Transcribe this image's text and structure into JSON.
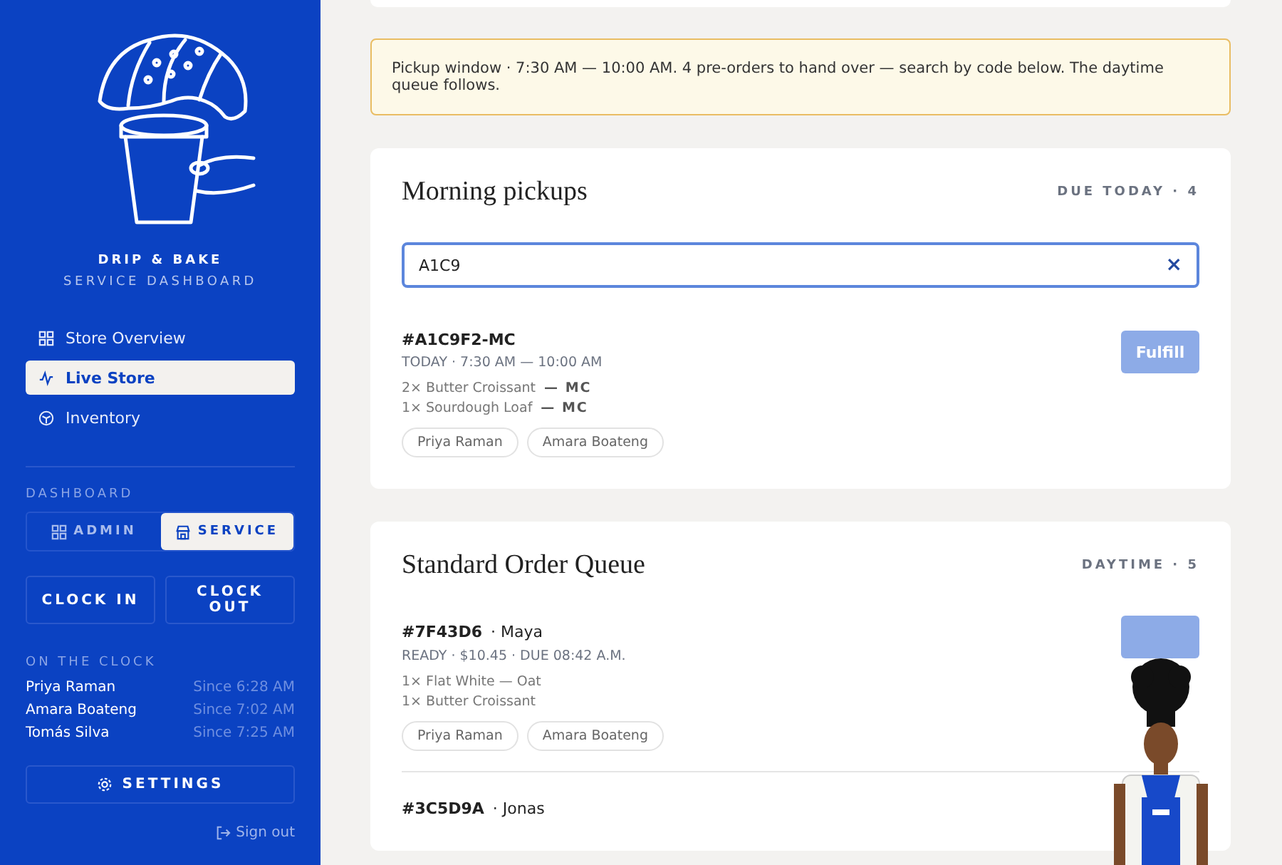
{
  "sidebar": {
    "brand": "DRIP & BAKE",
    "subtitle": "SERVICE DASHBOARD",
    "nav": [
      {
        "label": "Store Overview",
        "selected": false
      },
      {
        "label": "Live Store",
        "selected": true
      },
      {
        "label": "Inventory",
        "selected": false
      }
    ],
    "dashboard_label": "DASHBOARD",
    "mode_toggle": [
      {
        "label": "ADMIN",
        "selected": false
      },
      {
        "label": "SERVICE",
        "selected": true
      }
    ],
    "clock_buttons": [
      "CLOCK IN",
      "CLOCK OUT"
    ],
    "on_clock_label": "ON THE CLOCK",
    "staff": [
      {
        "name": "Priya Raman",
        "since": "Since 6:28 AM"
      },
      {
        "name": "Amara Boateng",
        "since": "Since 7:02 AM"
      },
      {
        "name": "Tomás Silva",
        "since": "Since 7:25 AM"
      }
    ],
    "settings": "SETTINGS",
    "sign_out": "Sign out"
  },
  "banner": "Pickup window · 7:30 AM — 10:00 AM. 4 pre-orders to hand over — search by code below. The daytime queue follows.",
  "pickups": {
    "title": "Morning pickups",
    "badge": "DUE TODAY · 4",
    "search": {
      "value": "A1C9",
      "clear": "×"
    },
    "orders": [
      {
        "code": "#A1C9F2-MC",
        "meta": "TODAY · 7:30 AM — 10:00 AM",
        "items": [
          {
            "text": "2× Butter Croissant",
            "tag": "— MC"
          },
          {
            "text": "1× Sourdough Loaf",
            "tag": "— MC"
          }
        ],
        "staff": [
          "Priya Raman",
          "Amara Boateng"
        ],
        "button": "Fulfill",
        "disabled": true
      }
    ]
  },
  "queue": {
    "title": "Standard Order Queue",
    "badge": "DAYTIME · 5",
    "orders": [
      {
        "code": "#7F43D6",
        "customer": "· Maya",
        "meta": "READY · $10.45  · DUE 08:42 A.M.",
        "items": [
          "1× Flat White — Oat",
          "1× Butter Croissant"
        ],
        "staff": [
          "Priya Raman",
          "Amara Boateng"
        ],
        "disabled": true
      },
      {
        "code": "#3C5D9A",
        "customer": "· Jonas"
      }
    ]
  }
}
